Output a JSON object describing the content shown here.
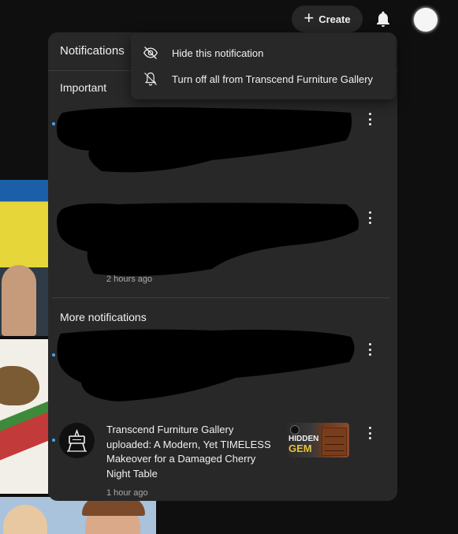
{
  "topbar": {
    "create_label": "Create",
    "icons": [
      "plus-icon",
      "bell-icon",
      "avatar"
    ]
  },
  "panel": {
    "title": "Notifications",
    "sections": {
      "important": "Important",
      "more": "More notifications"
    },
    "notifications": [
      {
        "section": "important",
        "time": "",
        "redacted": true
      },
      {
        "section": "important",
        "time": "2 hours ago",
        "redacted": true
      },
      {
        "section": "more",
        "time": "",
        "redacted": true
      },
      {
        "section": "more",
        "lines": [
          "Transcend Furniture Gallery",
          "uploaded: A Modern, Yet TIMELESS",
          "Makeover for a Damaged Cherry",
          "Night Table"
        ],
        "time": "1 hour ago",
        "thumb": {
          "line1": "HIDDEN",
          "line2": "GEM"
        }
      }
    ]
  },
  "menu": {
    "items": [
      {
        "label": "Hide this notification",
        "icon": "eye-off-icon"
      },
      {
        "label": "Turn off all from Transcend Furniture Gallery",
        "icon": "bell-off-icon"
      }
    ]
  },
  "colors": {
    "panel_bg": "#282828",
    "page_bg": "#0f0f0f",
    "unread_dot": "#3ea6ff",
    "text_secondary": "#aaaaaa"
  }
}
